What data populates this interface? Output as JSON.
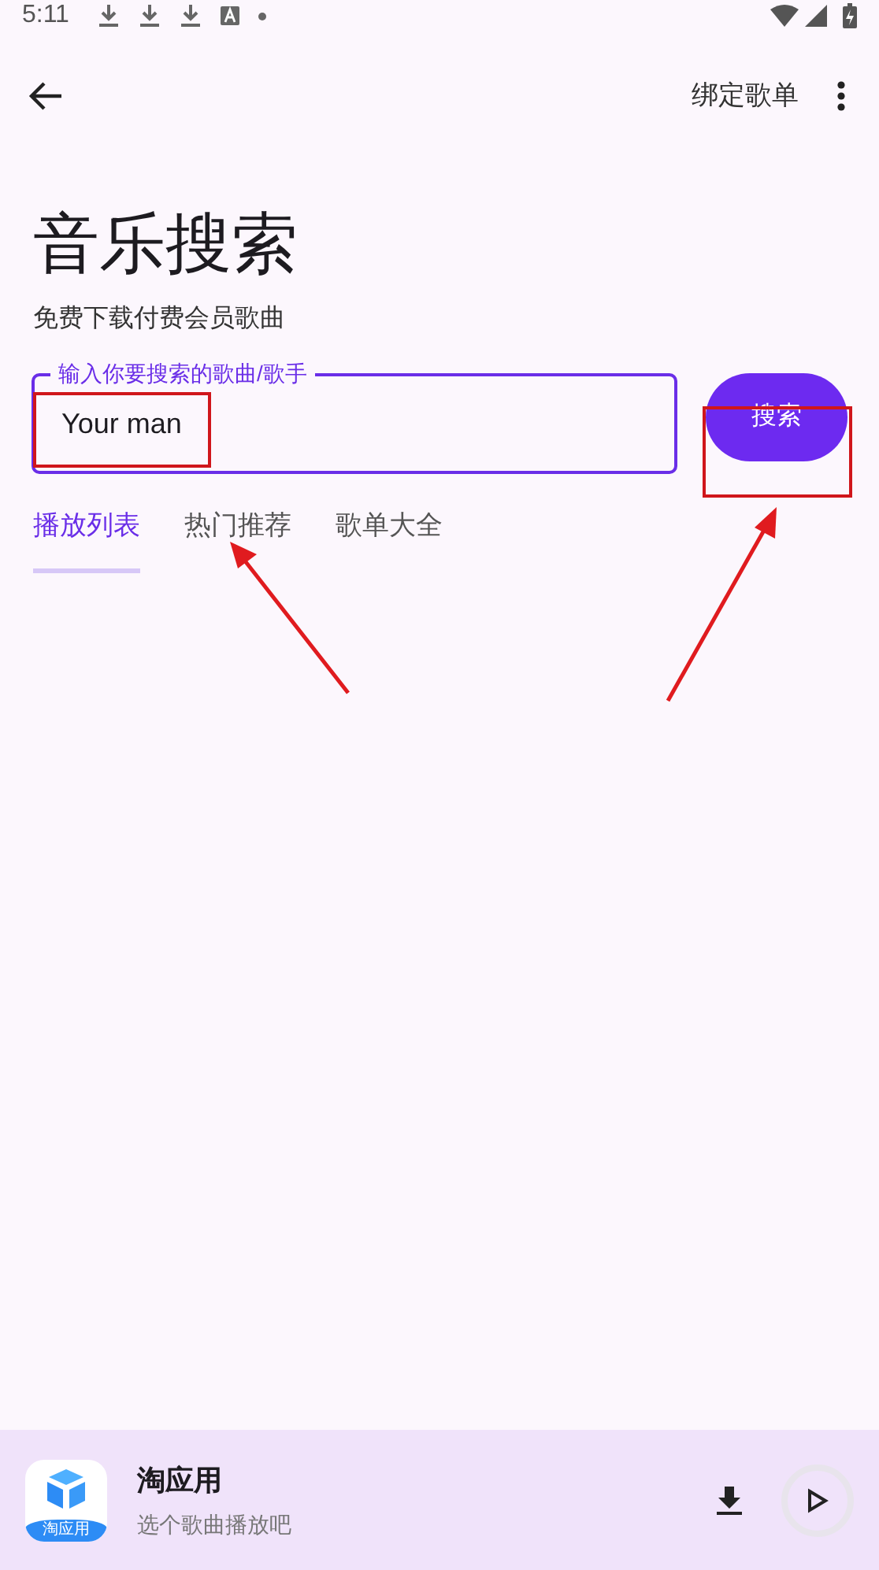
{
  "status_bar": {
    "time": "5:11"
  },
  "top_bar": {
    "action": "绑定歌单"
  },
  "header": {
    "title": "音乐搜索",
    "subtitle": "免费下载付费会员歌曲"
  },
  "search": {
    "label": "输入你要搜索的歌曲/歌手",
    "value": "Your man",
    "button": "搜索"
  },
  "tabs": [
    {
      "label": "播放列表",
      "selected": true
    },
    {
      "label": "热门推荐",
      "selected": false
    },
    {
      "label": "歌单大全",
      "selected": false
    }
  ],
  "player": {
    "icon_label": "淘应用",
    "title": "淘应用",
    "subtitle": "选个歌曲播放吧"
  }
}
